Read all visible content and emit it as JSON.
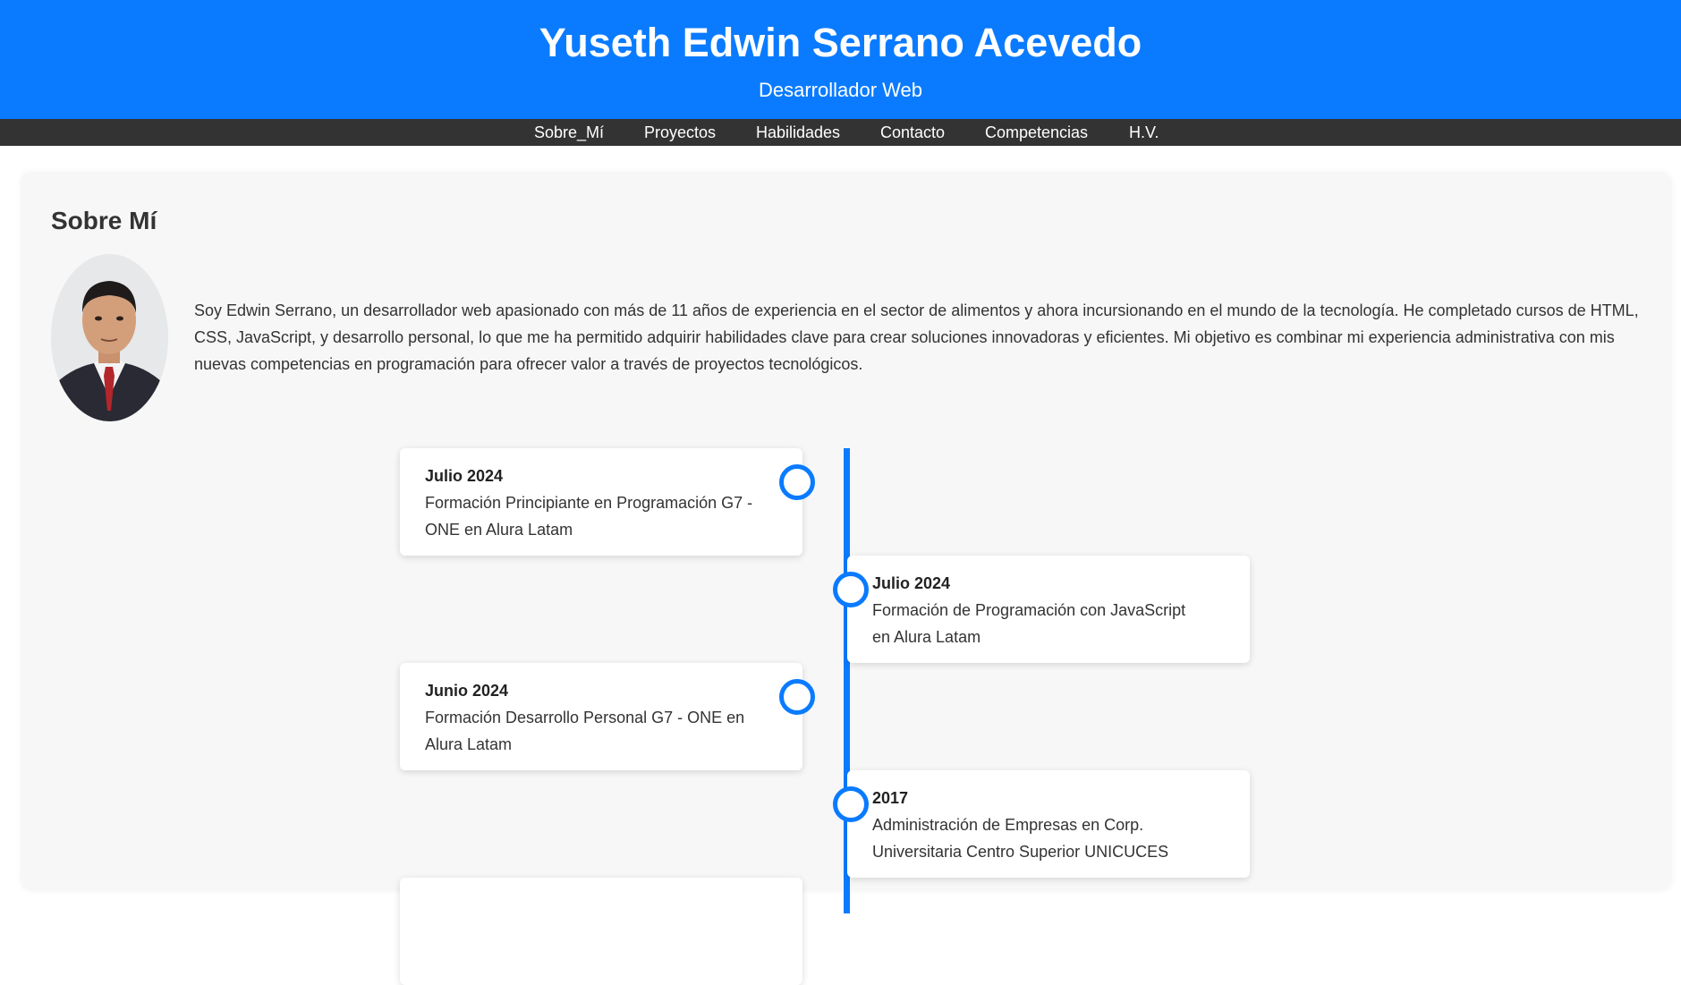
{
  "header": {
    "title": "Yuseth Edwin Serrano Acevedo",
    "subtitle": "Desarrollador Web"
  },
  "nav": {
    "items": [
      {
        "label": "Sobre_Mí"
      },
      {
        "label": "Proyectos"
      },
      {
        "label": "Habilidades"
      },
      {
        "label": "Contacto"
      },
      {
        "label": "Competencias"
      },
      {
        "label": "H.V."
      }
    ]
  },
  "about": {
    "title": "Sobre Mí",
    "text": "Soy Edwin Serrano, un desarrollador web apasionado con más de 11 años de experiencia en el sector de alimentos y ahora incursionando en el mundo de la tecnología. He completado cursos de HTML, CSS, JavaScript, y desarrollo personal, lo que me ha permitido adquirir habilidades clave para crear soluciones innovadoras y eficientes. Mi objetivo es combinar mi experiencia administrativa con mis nuevas competencias en programación para ofrecer valor a través de proyectos tecnológicos."
  },
  "timeline": {
    "entries": [
      {
        "date": "Julio 2024",
        "description": "Formación Principiante en Programación G7 - ONE en Alura Latam"
      },
      {
        "date": "Julio 2024",
        "description": "Formación de Programación con JavaScript en Alura Latam"
      },
      {
        "date": "Junio 2024",
        "description": "Formación Desarrollo Personal G7 - ONE en Alura Latam"
      },
      {
        "date": "2017",
        "description": "Administración de Empresas en Corp. Universitaria Centro Superior UNICUCES"
      }
    ]
  },
  "colors": {
    "primary": "#0a7bff",
    "nav_background": "#333333",
    "section_background": "#f7f7f7"
  }
}
